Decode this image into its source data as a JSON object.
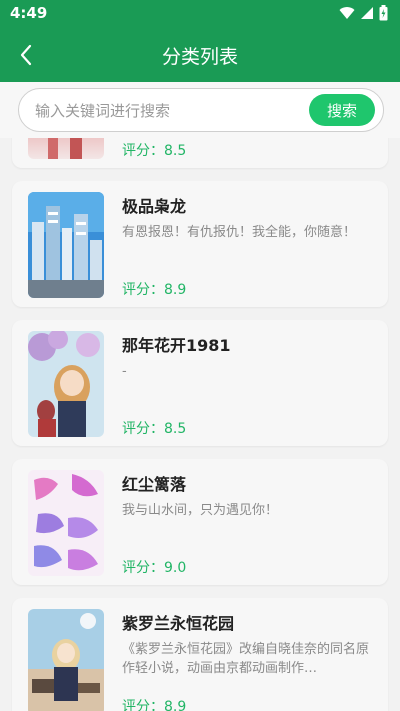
{
  "status": {
    "time": "4:49"
  },
  "header": {
    "title": "分类列表"
  },
  "search": {
    "placeholder": "输入关键词进行搜索",
    "button": "搜索"
  },
  "partial_item": {
    "score": "评分：8.5"
  },
  "items": [
    {
      "title": "极品枭龙",
      "desc": "有恩报恩！有仇报仇！我全能，你随意！",
      "score": "评分：8.9"
    },
    {
      "title": "那年花开1981",
      "desc": "-",
      "score": "评分：8.5"
    },
    {
      "title": "红尘篱落",
      "desc": "我与山水间，只为遇见你！",
      "score": "评分：9.0"
    },
    {
      "title": "紫罗兰永恒花园",
      "desc": "《紫罗兰永恒花园》改编自晓佳奈的同名原作轻小说，动画由京都动画制作…",
      "score": "评分：8.9"
    }
  ],
  "colors": {
    "primary": "#1a9b55",
    "accent": "#1fc66d",
    "score": "#22b566"
  },
  "icons": [
    "wifi-icon",
    "signal-icon",
    "battery-icon",
    "back-arrow-icon"
  ]
}
